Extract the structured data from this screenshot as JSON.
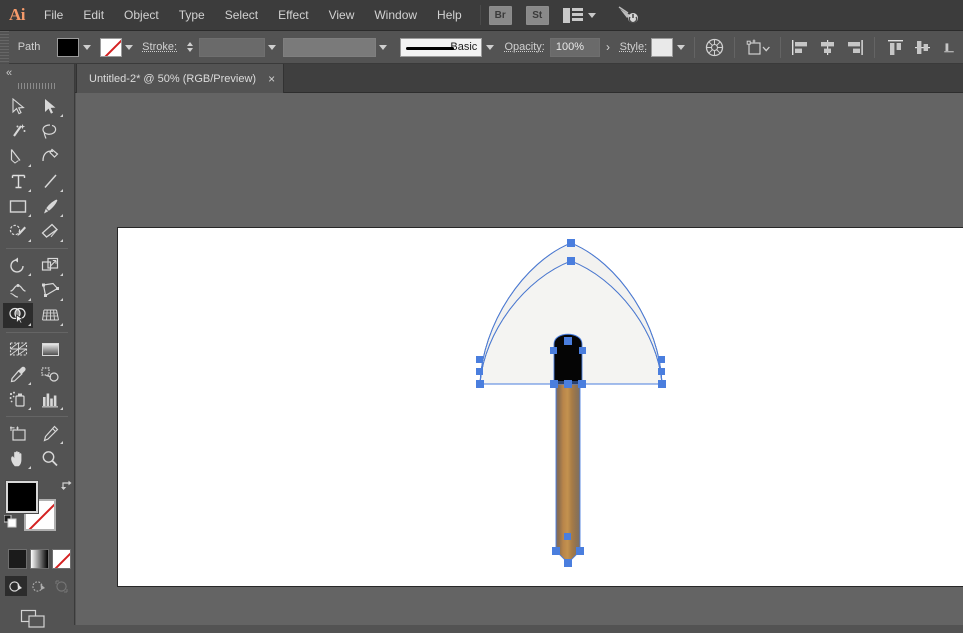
{
  "app": {
    "name": "Adobe Illustrator",
    "logo_text": "Ai"
  },
  "menubar": {
    "items": [
      {
        "label": "File"
      },
      {
        "label": "Edit"
      },
      {
        "label": "Object"
      },
      {
        "label": "Type"
      },
      {
        "label": "Select"
      },
      {
        "label": "Effect"
      },
      {
        "label": "View"
      },
      {
        "label": "Window"
      },
      {
        "label": "Help"
      }
    ],
    "bridge_label": "Br",
    "stock_label": "St",
    "arrange_icon": "arrange-documents-icon",
    "arrange_chevron_icon": "chevron-down-icon",
    "brush_tool_icon": "brush-sweep-icon"
  },
  "control_bar": {
    "object_type_label": "Path",
    "fill_swatch": {
      "name": "fill-swatch",
      "color": "#000000"
    },
    "fill_dropdown_icon": "chevron-down-icon",
    "stroke_swatch": {
      "name": "stroke-swatch",
      "color": "none"
    },
    "stroke_dropdown_icon": "chevron-down-icon",
    "stroke_label": "Stroke:",
    "stroke_weight_value": "",
    "stroke_weight_placeholder": "",
    "variable_width_value": "",
    "brush_definition": "Basic",
    "opacity_label": "Opacity:",
    "opacity_value": "100%",
    "opacity_chevron": "›",
    "style_label": "Style:",
    "style_swatch_color": "#e9e9e9",
    "recolor_icon": "recolor-artwork-icon",
    "transform_icon": "transform-shape-icon",
    "align_icons": [
      "align-left-icon",
      "align-horizontal-center-icon",
      "align-right-icon",
      "align-top-icon",
      "align-vertical-center-icon",
      "align-bottom-icon"
    ]
  },
  "document": {
    "tab_title": "Untitled-2* @ 50% (RGB/Preview)",
    "close_label": "×",
    "zoom_level": "50%",
    "color_mode": "RGB",
    "view_mode": "Preview",
    "modified": true
  },
  "tool_panel": {
    "collapse_icon": "collapse-panel-icon",
    "collapse_label": "«",
    "tools": [
      {
        "name": "selection-tool",
        "label": "Selection",
        "selected": false,
        "flyout": false
      },
      {
        "name": "direct-selection-tool",
        "label": "Direct Selection",
        "selected": false,
        "flyout": true
      },
      {
        "name": "magic-wand-tool",
        "label": "Magic Wand",
        "selected": false,
        "flyout": false
      },
      {
        "name": "lasso-tool",
        "label": "Lasso",
        "selected": false,
        "flyout": false
      },
      {
        "name": "pen-tool",
        "label": "Pen",
        "selected": false,
        "flyout": true
      },
      {
        "name": "curvature-tool",
        "label": "Curvature",
        "selected": false,
        "flyout": false
      },
      {
        "name": "type-tool",
        "label": "Type",
        "selected": false,
        "flyout": true
      },
      {
        "name": "line-segment-tool",
        "label": "Line Segment",
        "selected": false,
        "flyout": true
      },
      {
        "name": "rectangle-tool",
        "label": "Rectangle",
        "selected": false,
        "flyout": true
      },
      {
        "name": "paintbrush-tool",
        "label": "Paintbrush",
        "selected": false,
        "flyout": true
      },
      {
        "name": "shaper-tool",
        "label": "Shaper",
        "selected": false,
        "flyout": true
      },
      {
        "name": "eraser-tool",
        "label": "Eraser",
        "selected": false,
        "flyout": true
      },
      {
        "name": "rotate-tool",
        "label": "Rotate",
        "selected": false,
        "flyout": true
      },
      {
        "name": "scale-tool",
        "label": "Scale",
        "selected": false,
        "flyout": true
      },
      {
        "name": "width-tool",
        "label": "Width",
        "selected": false,
        "flyout": true
      },
      {
        "name": "free-transform-tool",
        "label": "Free Transform",
        "selected": false,
        "flyout": true
      },
      {
        "name": "shape-builder-tool",
        "label": "Shape Builder",
        "selected": true,
        "flyout": true
      },
      {
        "name": "perspective-grid-tool",
        "label": "Perspective Grid",
        "selected": false,
        "flyout": true
      },
      {
        "name": "mesh-tool",
        "label": "Mesh",
        "selected": false,
        "flyout": false
      },
      {
        "name": "gradient-tool",
        "label": "Gradient",
        "selected": false,
        "flyout": false
      },
      {
        "name": "eyedropper-tool",
        "label": "Eyedropper",
        "selected": false,
        "flyout": true
      },
      {
        "name": "blend-tool",
        "label": "Blend",
        "selected": false,
        "flyout": false
      },
      {
        "name": "symbol-sprayer-tool",
        "label": "Symbol Sprayer",
        "selected": false,
        "flyout": true
      },
      {
        "name": "column-graph-tool",
        "label": "Column Graph",
        "selected": false,
        "flyout": true
      },
      {
        "name": "artboard-tool",
        "label": "Artboard",
        "selected": false,
        "flyout": false
      },
      {
        "name": "slice-tool",
        "label": "Slice",
        "selected": false,
        "flyout": true
      },
      {
        "name": "hand-tool",
        "label": "Hand",
        "selected": false,
        "flyout": true
      },
      {
        "name": "zoom-tool",
        "label": "Zoom",
        "selected": false,
        "flyout": false
      }
    ],
    "fill_color": "#000000",
    "stroke_color": "none",
    "swap_icon": "swap-fill-stroke-icon",
    "default_icon": "default-fill-stroke-icon",
    "mode_buttons": [
      {
        "name": "color-mode-button",
        "label": "Color"
      },
      {
        "name": "gradient-mode-button",
        "label": "Gradient"
      },
      {
        "name": "none-mode-button",
        "label": "None"
      }
    ],
    "draw_modes": [
      {
        "name": "draw-normal-button",
        "label": "Draw Normal",
        "active": true
      },
      {
        "name": "draw-behind-button",
        "label": "Draw Behind",
        "active": false
      },
      {
        "name": "draw-inside-button",
        "label": "Draw Inside",
        "active": false
      }
    ],
    "screen_mode": {
      "name": "change-screen-mode-button",
      "label": "Change Screen Mode"
    }
  },
  "canvas": {
    "background_color": "#646464",
    "artboard_color": "#ffffff",
    "artwork_name": "shovel-illustration",
    "selection_color": "#4a7ede",
    "objects": [
      {
        "name": "shovel-blade-outer",
        "fill": "#f2f2f0",
        "stroke": "#3a4a7a"
      },
      {
        "name": "shovel-blade-inner",
        "fill": "#f2f2f0",
        "stroke": "#3a4a7a"
      },
      {
        "name": "shovel-socket",
        "fill": "#050505"
      },
      {
        "name": "shovel-handle",
        "fill_gradient": [
          "#8a7058",
          "#c08d52",
          "#a87c46",
          "#7d6f63"
        ]
      }
    ]
  }
}
